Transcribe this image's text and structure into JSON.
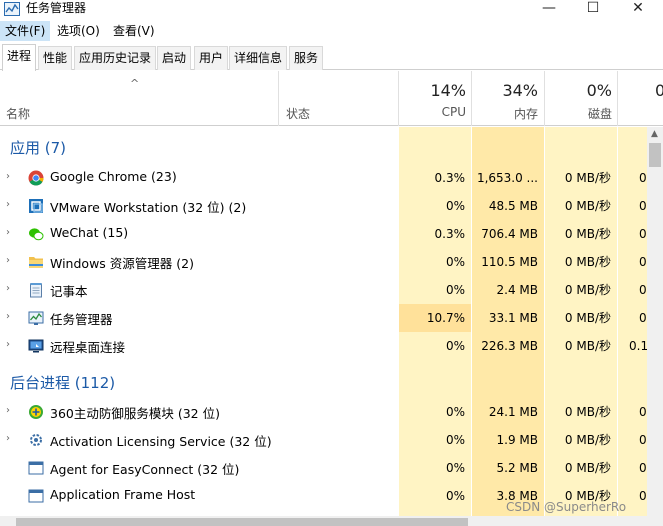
{
  "window": {
    "title": "任务管理器",
    "min_glyph": "—",
    "max_glyph": "☐",
    "close_glyph": "✕"
  },
  "menu": [
    "文件(F)",
    "选项(O)",
    "查看(V)"
  ],
  "tabs": [
    "进程",
    "性能",
    "应用历史记录",
    "启动",
    "用户",
    "详细信息",
    "服务"
  ],
  "header": {
    "sort_glyph": "^",
    "name": "名称",
    "status": "状态",
    "cpu_pct": "14%",
    "cpu_label": "CPU",
    "mem_pct": "34%",
    "mem_label": "内存",
    "disk_pct": "0%",
    "disk_label": "磁盘",
    "net_pct": "0"
  },
  "groups": {
    "apps": "应用 (7)",
    "background": "后台进程 (112)"
  },
  "expander_glyph": "›",
  "rows": [
    {
      "name": "Google Chrome (23)",
      "icon": "chrome-icon",
      "cpu": "0.3%",
      "mem": "1,653.0 ...",
      "disk": "0 MB/秒",
      "net": "0"
    },
    {
      "name": "VMware Workstation (32 位) (2)",
      "icon": "vmware-icon",
      "cpu": "0%",
      "mem": "48.5 MB",
      "disk": "0 MB/秒",
      "net": "0"
    },
    {
      "name": "WeChat (15)",
      "icon": "wechat-icon",
      "cpu": "0.3%",
      "mem": "706.4 MB",
      "disk": "0 MB/秒",
      "net": "0"
    },
    {
      "name": "Windows 资源管理器 (2)",
      "icon": "folder-icon",
      "cpu": "0%",
      "mem": "110.5 MB",
      "disk": "0 MB/秒",
      "net": "0"
    },
    {
      "name": "记事本",
      "icon": "notepad-icon",
      "cpu": "0%",
      "mem": "2.4 MB",
      "disk": "0 MB/秒",
      "net": "0"
    },
    {
      "name": "任务管理器",
      "icon": "task-manager-icon",
      "cpu": "10.7%",
      "mem": "33.1 MB",
      "disk": "0 MB/秒",
      "net": "0"
    },
    {
      "name": "远程桌面连接",
      "icon": "remote-desktop-icon",
      "cpu": "0%",
      "mem": "226.3 MB",
      "disk": "0 MB/秒",
      "net": "0.1"
    },
    {
      "name": "360主动防御服务模块 (32 位)",
      "icon": "shield-360-icon",
      "cpu": "0%",
      "mem": "24.1 MB",
      "disk": "0 MB/秒",
      "net": "0"
    },
    {
      "name": "Activation Licensing Service (32 位)",
      "icon": "service-icon",
      "cpu": "0%",
      "mem": "1.9 MB",
      "disk": "0 MB/秒",
      "net": "0"
    },
    {
      "name": "Agent for EasyConnect (32 位)",
      "icon": "app-window-icon",
      "cpu": "0%",
      "mem": "5.2 MB",
      "disk": "0 MB/秒",
      "net": "0"
    },
    {
      "name": "Application Frame Host",
      "icon": "app-window-icon",
      "cpu": "0%",
      "mem": "3.8 MB",
      "disk": "0 MB/秒",
      "net": "0"
    }
  ],
  "watermark": "CSDN @SuperherRo",
  "colors": {
    "group_title": "#1c5aa7",
    "heat_low": "#fff4c4",
    "heat_mid": "#ffe9a8",
    "heat_high": "#ffe19a"
  }
}
